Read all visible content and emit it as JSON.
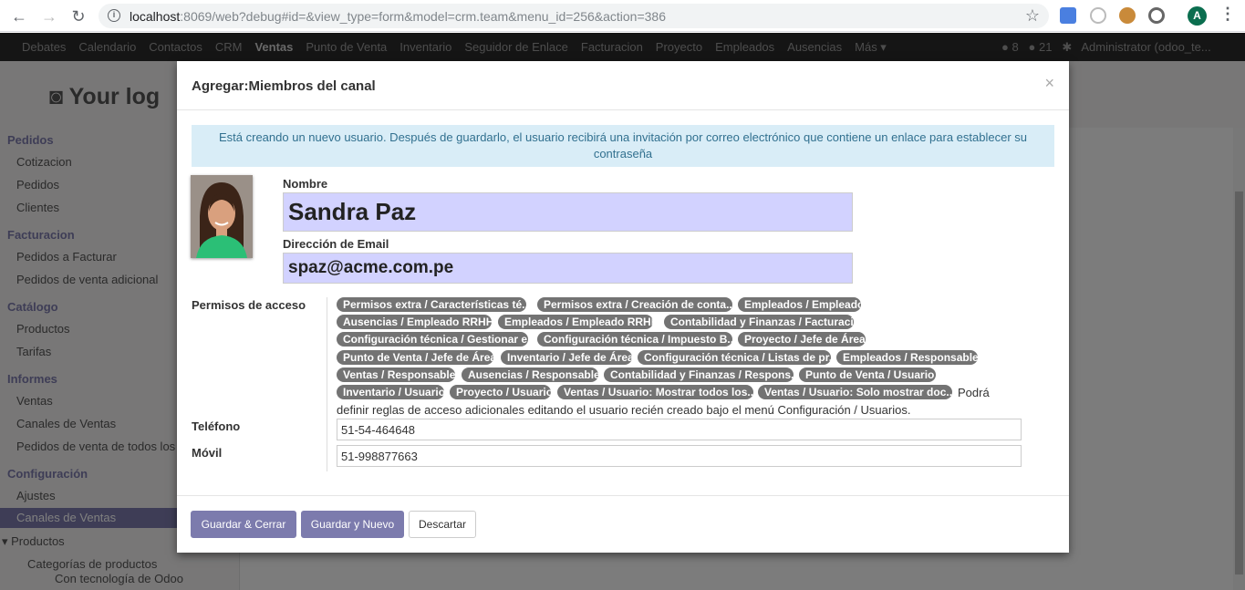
{
  "browser": {
    "back_icon": "←",
    "forward_icon": "→",
    "reload_icon": "↻",
    "url_host": "localhost",
    "url_rest": ":8069/web?debug#id=&view_type=form&model=crm.team&menu_id=256&action=386",
    "profile_initial": "A"
  },
  "topnav": {
    "items": [
      "Debates",
      "Calendario",
      "Contactos",
      "CRM",
      "Ventas",
      "Punto de Venta",
      "Inventario",
      "Seguidor de Enlace",
      "Facturacion",
      "Proyecto",
      "Empleados",
      "Ausencias",
      "Más ▾"
    ],
    "active": "Ventas",
    "badge_1": "8",
    "badge_2": "21",
    "user": "Administrator (odoo_te..."
  },
  "background": {
    "logo": "Your log",
    "sidebar": [
      {
        "type": "hdr",
        "label": "Pedidos"
      },
      {
        "type": "item",
        "label": "Cotizacion"
      },
      {
        "type": "item",
        "label": "Pedidos"
      },
      {
        "type": "item",
        "label": "Clientes"
      },
      {
        "type": "hdr",
        "label": "Facturacion"
      },
      {
        "type": "item",
        "label": "Pedidos a Facturar"
      },
      {
        "type": "item",
        "label": "Pedidos de venta adicional"
      },
      {
        "type": "hdr",
        "label": "Catálogo"
      },
      {
        "type": "item",
        "label": "Productos"
      },
      {
        "type": "item",
        "label": "Tarifas"
      },
      {
        "type": "hdr",
        "label": "Informes"
      },
      {
        "type": "item",
        "label": "Ventas"
      },
      {
        "type": "item",
        "label": "Canales de Ventas"
      },
      {
        "type": "item",
        "label": "Pedidos de venta de todos los"
      },
      {
        "type": "hdr",
        "label": "Configuración"
      },
      {
        "type": "item",
        "label": "Ajustes"
      },
      {
        "type": "selected",
        "label": "Canales de Ventas"
      },
      {
        "type": "item",
        "label": "▾ Productos"
      },
      {
        "type": "item",
        "label": "Categorías de productos"
      }
    ],
    "powered_by": "Con tecnología de Odoo"
  },
  "modal": {
    "title": "Agregar:Miembros del canal",
    "close_icon": "×",
    "alert": "Está creando un nuevo usuario. Después de guardarlo, el usuario recibirá una invitación por correo electrónico que contiene un enlace para establecer su contraseña",
    "name_label": "Nombre",
    "name_value": "Sandra Paz",
    "email_label": "Dirección de Email",
    "email_value": "spaz@acme.com.pe",
    "permissions_label": "Permisos de acceso",
    "tags": [
      "Permisos extra / Características té...",
      "Permisos extra / Creación de conta...",
      "Empleados / Empleado",
      "Ausencias / Empleado RRHH",
      "Empleados / Empleado RRHH",
      "Contabilidad y Finanzas / Facturaci...",
      "Configuración técnica / Gestionar e...",
      "Configuración técnica / Impuesto B...",
      "Proyecto / Jefe de Área",
      "Punto de Venta / Jefe de Área",
      "Inventario / Jefe de Área",
      "Configuración técnica / Listas de pr...",
      "Empleados / Responsable",
      "Ventas / Responsable",
      "Ausencias / Responsable",
      "Contabilidad y Finanzas / Respons...",
      "Punto de Venta / Usuario",
      "Inventario / Usuario",
      "Proyecto / Usuario",
      "Ventas / Usuario: Mostrar todos los...",
      "Ventas / Usuario: Solo mostrar doc..."
    ],
    "note_part1": "Podrá",
    "note_part2": "definir reglas de acceso adicionales editando el usuario recién creado bajo el menú Configuración / Usuarios.",
    "phone_label": "Teléfono",
    "phone_value": "51-54-464648",
    "mobile_label": "Móvil",
    "mobile_value": "51-998877663",
    "btn_save_close": "Guardar & Cerrar",
    "btn_save_new": "Guardar y Nuevo",
    "btn_discard": "Descartar"
  }
}
